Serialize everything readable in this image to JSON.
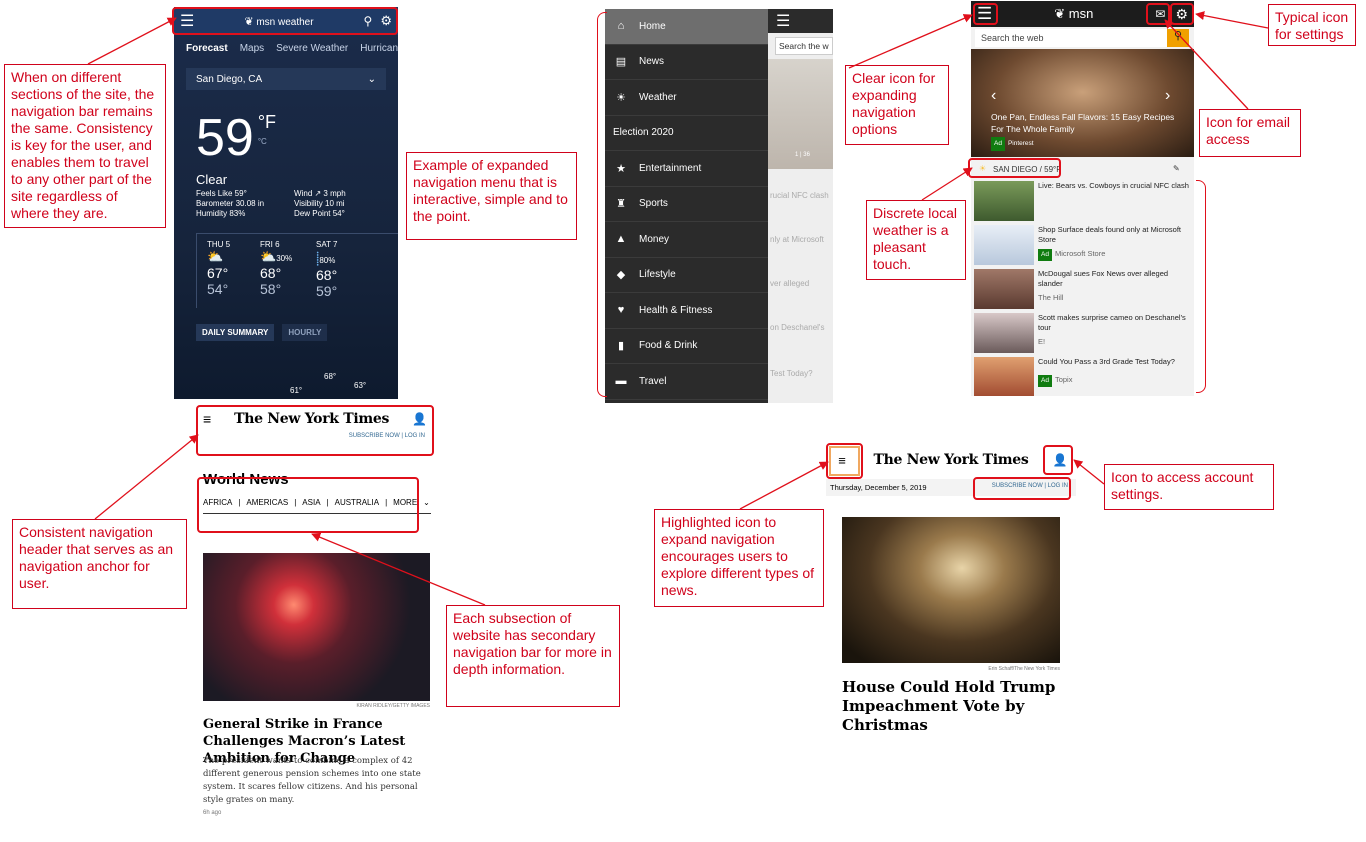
{
  "annotations": {
    "weather_nav": "When on different sections of the site, the navigation bar remains the same. Consistency is key for the user, and enables them to travel to any other part of the site regardless of where they are.",
    "expanded_menu": "Example of expanded navigation menu that is interactive, simple and to the point.",
    "clear_icon": "Clear icon for expanding navigation options",
    "settings_icon": "Typical icon for settings",
    "email_icon": "Icon for email access",
    "local_weather": "Discrete local weather is a pleasant touch.",
    "consistent_header": "Consistent navigation header that serves as an navigation anchor for user.",
    "secondary_nav": "Each subsection of website has secondary navigation bar for more in depth information.",
    "highlighted_icon": "Highlighted icon to expand navigation encourages users to explore different types of news.",
    "account_icon": "Icon to access account settings."
  },
  "msn_weather": {
    "brand": "msn weather",
    "tabs": [
      "Forecast",
      "Maps",
      "Severe Weather",
      "Hurrican"
    ],
    "location": "San Diego, CA",
    "temp": "59",
    "unit_f": "°F",
    "unit_c": "°C",
    "condition": "Clear",
    "feels_like": "Feels Like 59°",
    "barometer": "Barometer 30.08 in",
    "humidity": "Humidity 83%",
    "wind": "Wind ↗ 3 mph",
    "visibility": "Visibility 10 mi",
    "dew_point": "Dew Point 54°",
    "days": [
      {
        "name": "THU 5",
        "precip": "",
        "high": "67°",
        "low": "54°"
      },
      {
        "name": "FRI 6",
        "precip": "30%",
        "high": "68°",
        "low": "58°"
      },
      {
        "name": "SAT 7",
        "precip": "80%",
        "high": "68°",
        "low": "59°"
      }
    ],
    "summary_btn": "DAILY SUMMARY",
    "hourly_btn": "HOURLY",
    "graph_labels": [
      "68°",
      "61°",
      "63°"
    ]
  },
  "msn_menu": {
    "search_placeholder": "Search the w",
    "items": [
      "Home",
      "News",
      "Weather",
      "Election 2020",
      "Entertainment",
      "Sports",
      "Money",
      "Lifestyle",
      "Health & Fitness",
      "Food & Drink",
      "Travel"
    ],
    "peek_counter": "1 | 36",
    "peek_texts": [
      "rucial NFC clash",
      "nly at Microsoft",
      "ver alleged",
      "on Deschanel's",
      "Test Today?"
    ]
  },
  "msn_home": {
    "brand": "msn",
    "search_placeholder": "Search the web",
    "hero_caption": "One Pan, Endless Fall Flavors: 15 Easy Recipes For The Whole Family",
    "hero_ad": "Ad",
    "hero_source": "Pinterest",
    "weather": "SAN DIEGO / 59°F",
    "news": [
      {
        "title": "Live: Bears vs. Cowboys in crucial NFC clash",
        "source": "",
        "ad": ""
      },
      {
        "title": "Shop Surface deals found only at Microsoft Store",
        "source": "Microsoft Store",
        "ad": "Ad"
      },
      {
        "title": "McDougal sues Fox News over alleged slander",
        "source": "The Hill",
        "ad": ""
      },
      {
        "title": "Scott makes surprise cameo on Deschanel's tour",
        "source": "E!",
        "ad": ""
      },
      {
        "title": "Could You Pass a 3rd Grade Test Today?",
        "source": "Topix",
        "ad": "Ad"
      }
    ]
  },
  "nyt_world": {
    "logo": "The New York Times",
    "subscribe": "SUBSCRIBE NOW",
    "login": "LOG IN",
    "section_title": "World News",
    "subnav": [
      "AFRICA",
      "AMERICAS",
      "ASIA",
      "AUSTRALIA",
      "MORE"
    ],
    "photo_credit": "KIRAN RIDLEY/GETTY IMAGES",
    "headline": "General Strike in France Challenges Macron’s Latest Ambition for Change",
    "summary": "The president wants to combine a complex of 42 different generous pension schemes into one state system. It scares fellow citizens. And his personal style grates on many.",
    "time": "6h ago"
  },
  "nyt_home": {
    "logo": "The New York Times",
    "date": "Thursday, December 5, 2019",
    "subscribe": "SUBSCRIBE NOW",
    "login": "LOG IN",
    "photo_credit": "Erin Schaff/The New York Times",
    "headline": "House Could Hold Trump Impeachment Vote by Christmas"
  },
  "colors": {
    "annotation_red": "#d0021b",
    "msn_blue": "#1f3a66",
    "nyt_link": "#326891",
    "msn_ad_green": "#107c10"
  }
}
